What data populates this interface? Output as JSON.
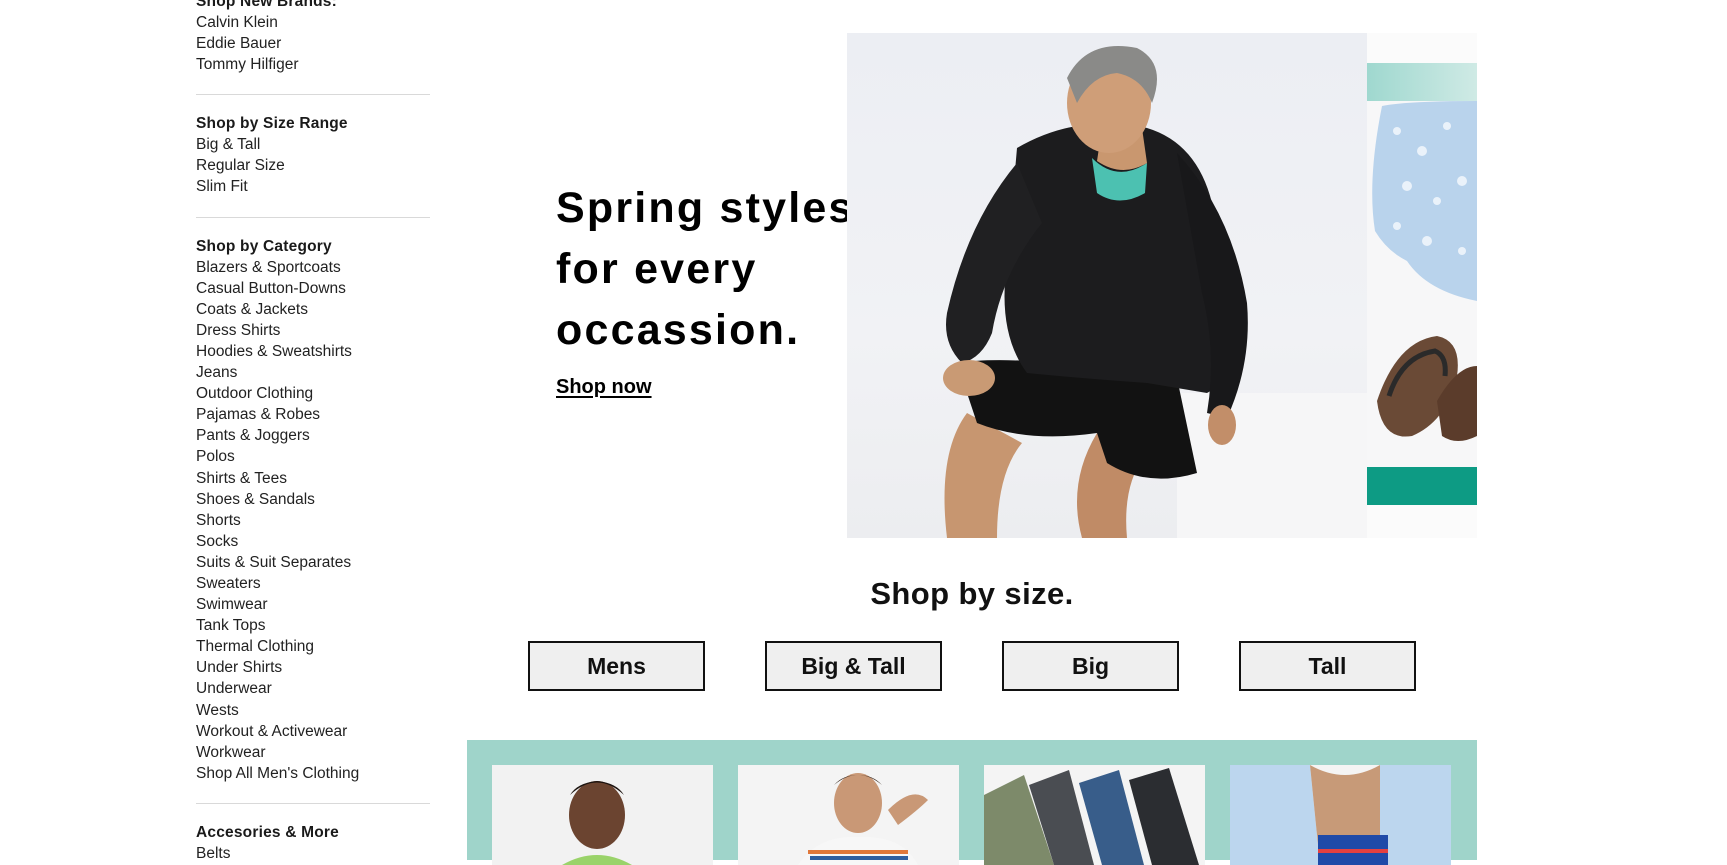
{
  "sidebar": {
    "brands_heading": "Shop New Brands:",
    "brands": [
      "Calvin Klein",
      "Eddie Bauer",
      "Tommy Hilfiger"
    ],
    "size_heading": "Shop by Size Range",
    "size_links": [
      "Big & Tall",
      "Regular Size",
      "Slim Fit"
    ],
    "category_heading": "Shop by Category",
    "category_links": [
      "Blazers & Sportcoats",
      "Casual Button-Downs",
      "Coats & Jackets",
      "Dress Shirts",
      "Hoodies & Sweatshirts",
      "Jeans",
      "Outdoor Clothing",
      "Pajamas & Robes",
      "Pants & Joggers",
      "Polos",
      "Shirts & Tees",
      "Shoes & Sandals",
      "Shorts",
      "Socks",
      "Suits & Suit Separates",
      "Sweaters",
      "Swimwear",
      "Tank Tops",
      "Thermal Clothing",
      "Under Shirts",
      "Underwear",
      "Wests",
      "Workout & Activewear",
      "Workwear",
      "Shop All Men's Clothing"
    ],
    "accessories_heading": "Accesories & More",
    "accessories_links": [
      "Belts"
    ]
  },
  "hero": {
    "title": "Spring styles for every occassion.",
    "cta": "Shop now"
  },
  "size_section": {
    "title": "Shop by size.",
    "buttons": [
      "Mens",
      "Big & Tall",
      "Big",
      "Tall"
    ]
  },
  "colors": {
    "band": "#9fd4ca",
    "teal_accent": "#0d9b84",
    "text": "#111111"
  }
}
